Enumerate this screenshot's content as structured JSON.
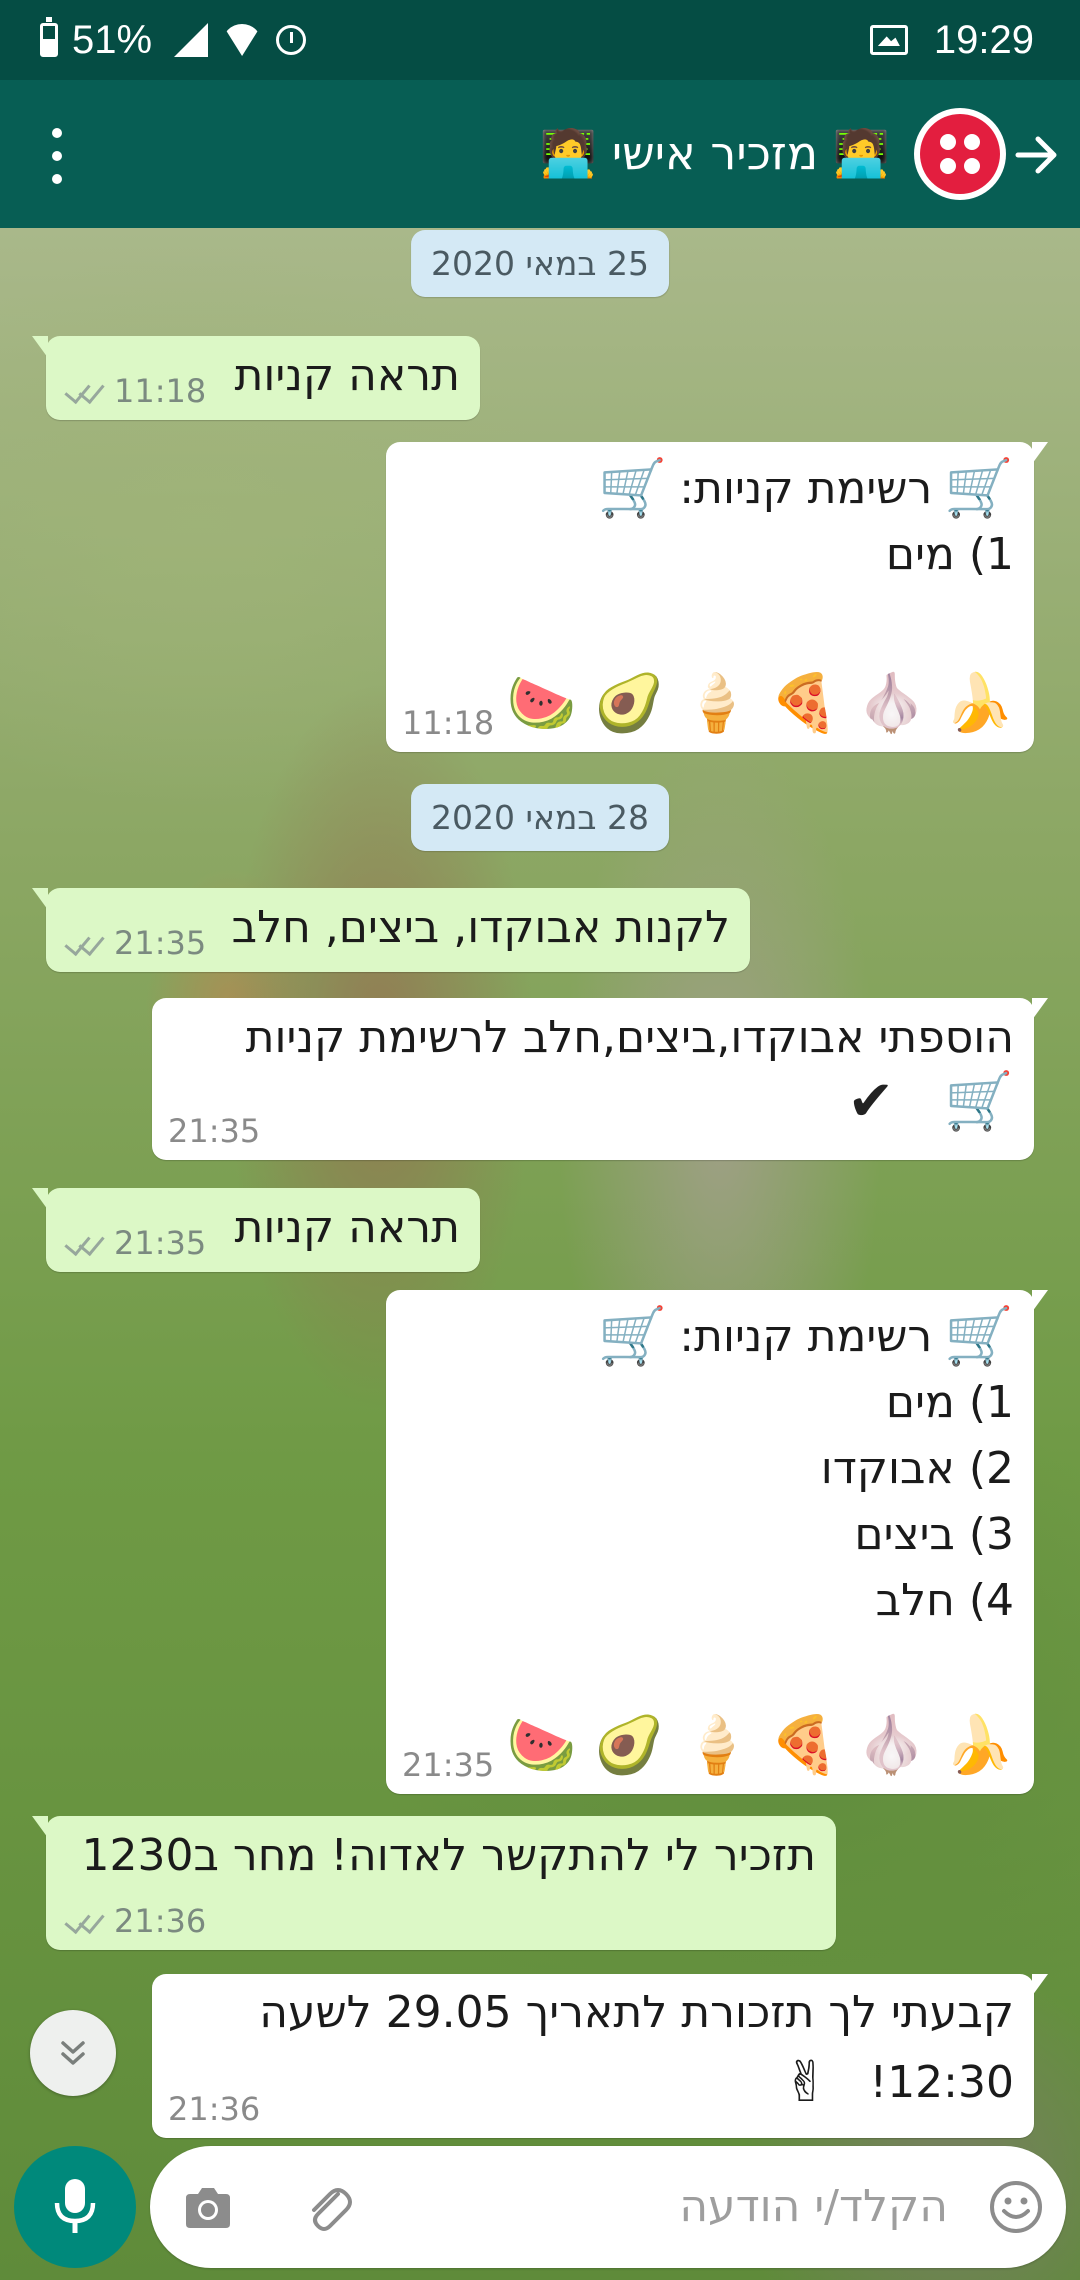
{
  "status_bar": {
    "battery": "51%",
    "time": "19:29",
    "icons": [
      "battery-icon",
      "signal-icon",
      "wifi-icon",
      "alarm-icon",
      "gallery-icon"
    ]
  },
  "header": {
    "title": "🧑‍💻 מזכיר אישי 🧑‍💻",
    "icons": [
      "back-arrow-icon",
      "avatar",
      "menu-icon"
    ],
    "colors": {
      "bar": "#075e54",
      "status": "#054d44",
      "avatar": "#e31e3f"
    }
  },
  "dates": {
    "d1": "25 במאי 2020",
    "d2": "28 במאי 2020"
  },
  "messages": {
    "m1": {
      "text": "תראה קניות",
      "time": "11:18"
    },
    "m2": {
      "title": "רשימת קניות:",
      "items": [
        "1) מים"
      ],
      "emojis": "🍌 🧄 🍕 🍦 🥑 🍉",
      "time": "11:18"
    },
    "m3": {
      "text": "לקנות אבוקדו, ביצים, חלב",
      "time": "21:35"
    },
    "m4": {
      "text": "הוספתי אבוקדו,ביצים,חלב לרשימת קניות",
      "time": "21:35"
    },
    "m5": {
      "text": "תראה קניות",
      "time": "21:35"
    },
    "m6": {
      "title": "רשימת קניות:",
      "items": [
        "1) מים",
        "2) אבוקדו",
        "3) ביצים",
        "4) חלב"
      ],
      "emojis": "🍌 🧄 🍕 🍦 🥑 🍉",
      "time": "21:35"
    },
    "m7": {
      "text": "תזכיר לי להתקשר לאדוה! מחר ב1230",
      "time": "21:36"
    },
    "m8": {
      "line1": "קבעתי לך תזכורת לתאריך 29.05 לשעה",
      "line2": "12:30!",
      "time": "21:36"
    }
  },
  "emoji_glyphs": {
    "cart": "🛒",
    "check": "✔",
    "victory": "✌"
  },
  "input": {
    "placeholder": "הקלד/י הודעה",
    "icons": [
      "emoji-icon",
      "attach-icon",
      "camera-icon",
      "mic-icon",
      "scroll-down-icon"
    ]
  },
  "colors": {
    "outgoing_bubble": "#dcf8c6",
    "incoming_bubble": "#ffffff",
    "date_chip": "#d4e9f5",
    "mic_button": "#00897b"
  }
}
